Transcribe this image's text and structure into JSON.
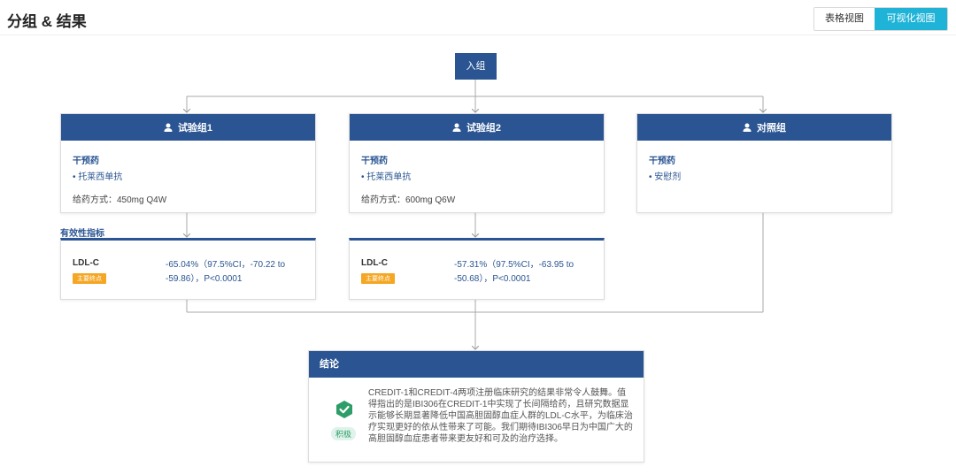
{
  "header": {
    "title": "分组 & 结果",
    "toggle_table": "表格视图",
    "toggle_visual": "可视化视图"
  },
  "enrollment": {
    "label": "入组"
  },
  "arms": [
    {
      "name": "试验组1",
      "intervention_title": "干预药",
      "drug": "• 托莱西单抗",
      "dosing": "给药方式：450mg Q4W"
    },
    {
      "name": "试验组2",
      "intervention_title": "干预药",
      "drug": "• 托莱西单抗",
      "dosing": "给药方式：600mg Q6W"
    },
    {
      "name": "对照组",
      "intervention_title": "干预药",
      "drug": "• 安慰剂",
      "dosing": ""
    }
  ],
  "efficacy": {
    "section_label": "有效性指标",
    "items": [
      {
        "name": "LDL-C",
        "badge": "主要终点",
        "result": "-65.04%（97.5%CI，-70.22 to -59.86），P<0.0001"
      },
      {
        "name": "LDL-C",
        "badge": "主要终点",
        "result": "-57.31%（97.5%CI，-63.95 to -50.68），P<0.0001"
      }
    ]
  },
  "conclusion": {
    "title": "结论",
    "badge": "积极",
    "text": "CREDIT-1和CREDIT-4两项注册临床研究的结果非常令人鼓舞。值得指出的是IBI306在CREDIT-1中实现了长间隔给药，且研究数据显示能够长期显著降低中国高胆固醇血症人群的LDL-C水平，为临床治疗实现更好的依从性带来了可能。我们期待IBI306早日为中国广大的高胆固醇血症患者带来更友好和可及的治疗选择。"
  },
  "colors": {
    "primary": "#2a5592",
    "accent": "#1fb3d7",
    "badge_orange": "#f5a623",
    "positive_green": "#2e9d6a"
  }
}
